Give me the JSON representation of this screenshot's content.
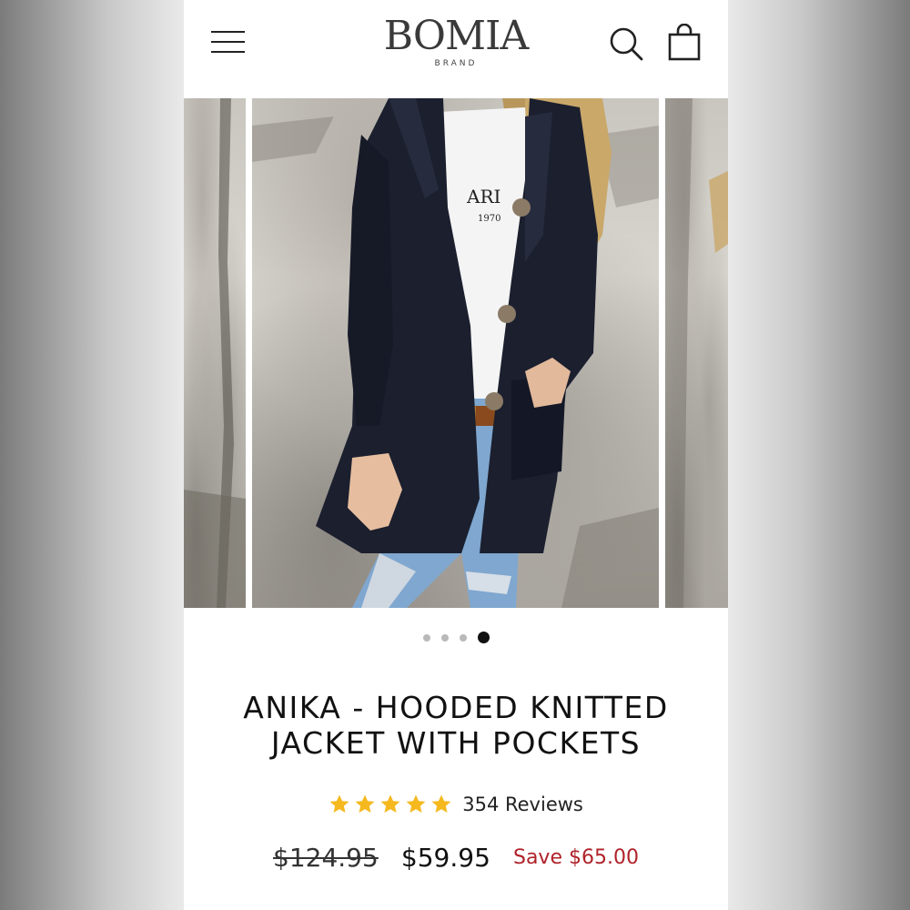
{
  "header": {
    "brand_name": "BOMIA",
    "brand_sub": "BRAND",
    "menu_icon": "hamburger-menu-icon",
    "search_icon": "search-icon",
    "cart_icon": "shopping-bag-icon"
  },
  "gallery": {
    "image_alt": "Model wearing navy hooded knitted jacket with buttons over white t-shirt and ripped jeans",
    "dots_count": 4,
    "active_index": 3,
    "shirt_print_lines": [
      "ARI",
      "1970"
    ]
  },
  "product": {
    "title": "ANIKA - HOODED KNITTED JACKET WITH POCKETS",
    "rating_stars": 5,
    "reviews_label": "354 Reviews",
    "original_price": "$124.95",
    "sale_price": "$59.95",
    "save_label": "Save $65.00"
  },
  "colors": {
    "star": "#f5b91f",
    "save_text": "#b0222a",
    "jacket": "#1b1f2e"
  }
}
